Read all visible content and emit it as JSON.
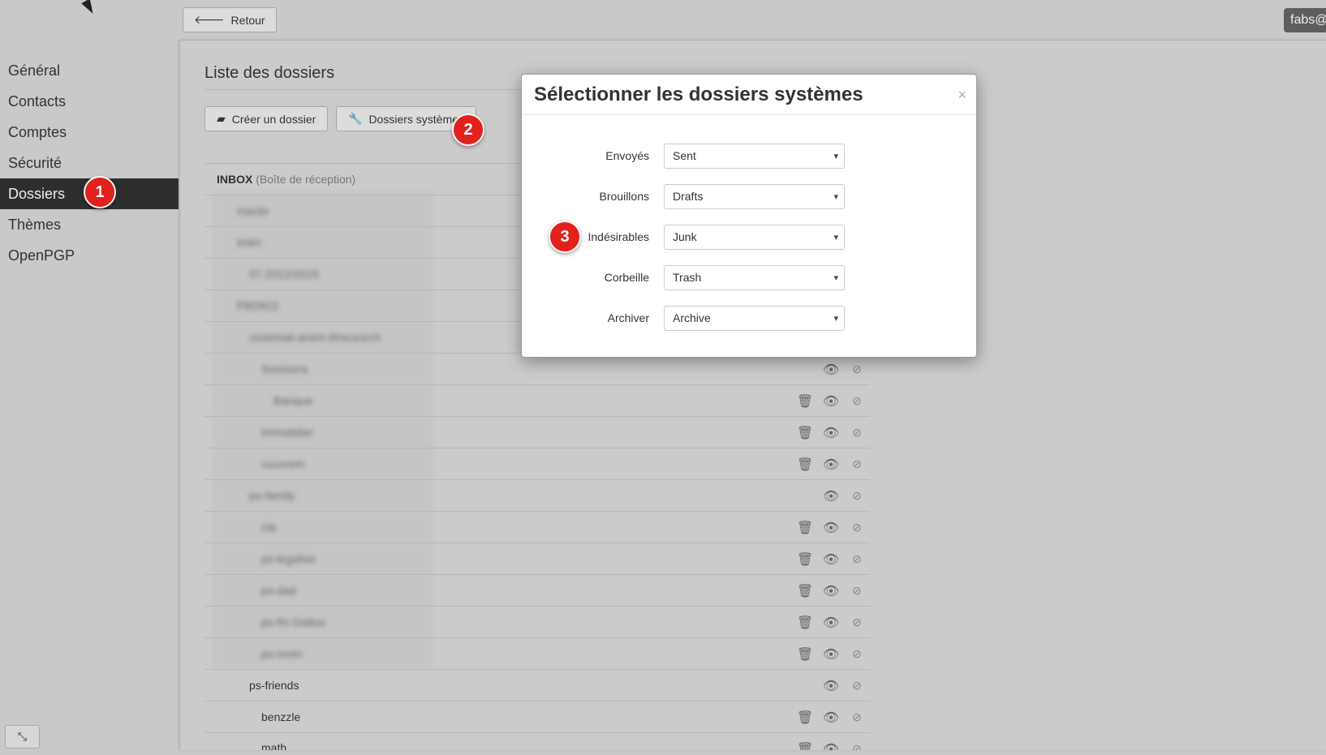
{
  "topbar": {
    "back_label": "Retour",
    "user_label": "fabs@"
  },
  "sidebar": {
    "items": [
      {
        "label": "Général"
      },
      {
        "label": "Contacts"
      },
      {
        "label": "Comptes"
      },
      {
        "label": "Sécurité"
      },
      {
        "label": "Dossiers"
      },
      {
        "label": "Thèmes"
      },
      {
        "label": "OpenPGP"
      }
    ],
    "active_index": 4
  },
  "main": {
    "title": "Liste des dossiers",
    "create_folder_label": "Créer un dossier",
    "system_folders_label": "Dossiers systèmes",
    "inbox_name": "INBOX",
    "inbox_sub": "(Boîte de réception)",
    "folders": [
      {
        "name": "inactiv"
      },
      {
        "name": "tmkn"
      },
      {
        "name": "07.2012/2015"
      },
      {
        "name": "FBD822"
      },
      {
        "name": "cio/email-ansm-il/recesrch"
      },
      {
        "name": "Sonisons"
      },
      {
        "name": "Banque"
      },
      {
        "name": "Immobilier"
      },
      {
        "name": "couvrem"
      },
      {
        "name": "ps-family"
      },
      {
        "name": "cla"
      },
      {
        "name": "ps-legalise"
      },
      {
        "name": "ps-dad"
      },
      {
        "name": "ps-fm Dattus"
      },
      {
        "name": "ps-mom"
      },
      {
        "name": "ps-friends"
      },
      {
        "name": "benzzle"
      },
      {
        "name": "math"
      }
    ]
  },
  "modal": {
    "title": "Sélectionner les dossiers systèmes",
    "close_label": "×",
    "fields": [
      {
        "label": "Envoyés",
        "value": "Sent"
      },
      {
        "label": "Brouillons",
        "value": "Drafts"
      },
      {
        "label": "Indésirables",
        "value": "Junk"
      },
      {
        "label": "Corbeille",
        "value": "Trash"
      },
      {
        "label": "Archiver",
        "value": "Archive"
      }
    ]
  },
  "markers": [
    "1",
    "2",
    "3"
  ],
  "colors": {
    "marker": "#e2211c",
    "sidebar_active": "#2e2e2e"
  }
}
